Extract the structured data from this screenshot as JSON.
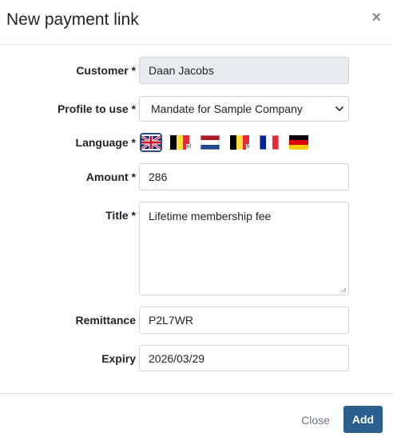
{
  "dialog": {
    "title": "New payment link",
    "close_symbol": "×"
  },
  "form": {
    "customer": {
      "label": "Customer *",
      "value": "Daan Jacobs"
    },
    "profile": {
      "label": "Profile to use *",
      "selected": "Mandate for Sample Company"
    },
    "language": {
      "label": "Language *",
      "options": [
        {
          "icon": "uk-flag-icon",
          "selected": true
        },
        {
          "icon": "belgium-nl-flag-icon",
          "tag": "nl",
          "selected": false
        },
        {
          "icon": "netherlands-flag-icon",
          "selected": false
        },
        {
          "icon": "belgium-fr-flag-icon",
          "tag": "fr",
          "selected": false
        },
        {
          "icon": "france-flag-icon",
          "selected": false
        },
        {
          "icon": "germany-flag-icon",
          "selected": false
        }
      ]
    },
    "amount": {
      "label": "Amount *",
      "value": "286"
    },
    "title": {
      "label": "Title *",
      "value": "Lifetime membership fee"
    },
    "remittance": {
      "label": "Remittance",
      "value": "P2L7WR"
    },
    "expiry": {
      "label": "Expiry",
      "value": "2026/03/29"
    }
  },
  "footer": {
    "close_label": "Close",
    "add_label": "Add"
  },
  "colors": {
    "primary": "#2b5f8e",
    "disabled_bg": "#e9ecef",
    "border": "#ced4da",
    "selected_flag_border": "#2f4d80"
  }
}
